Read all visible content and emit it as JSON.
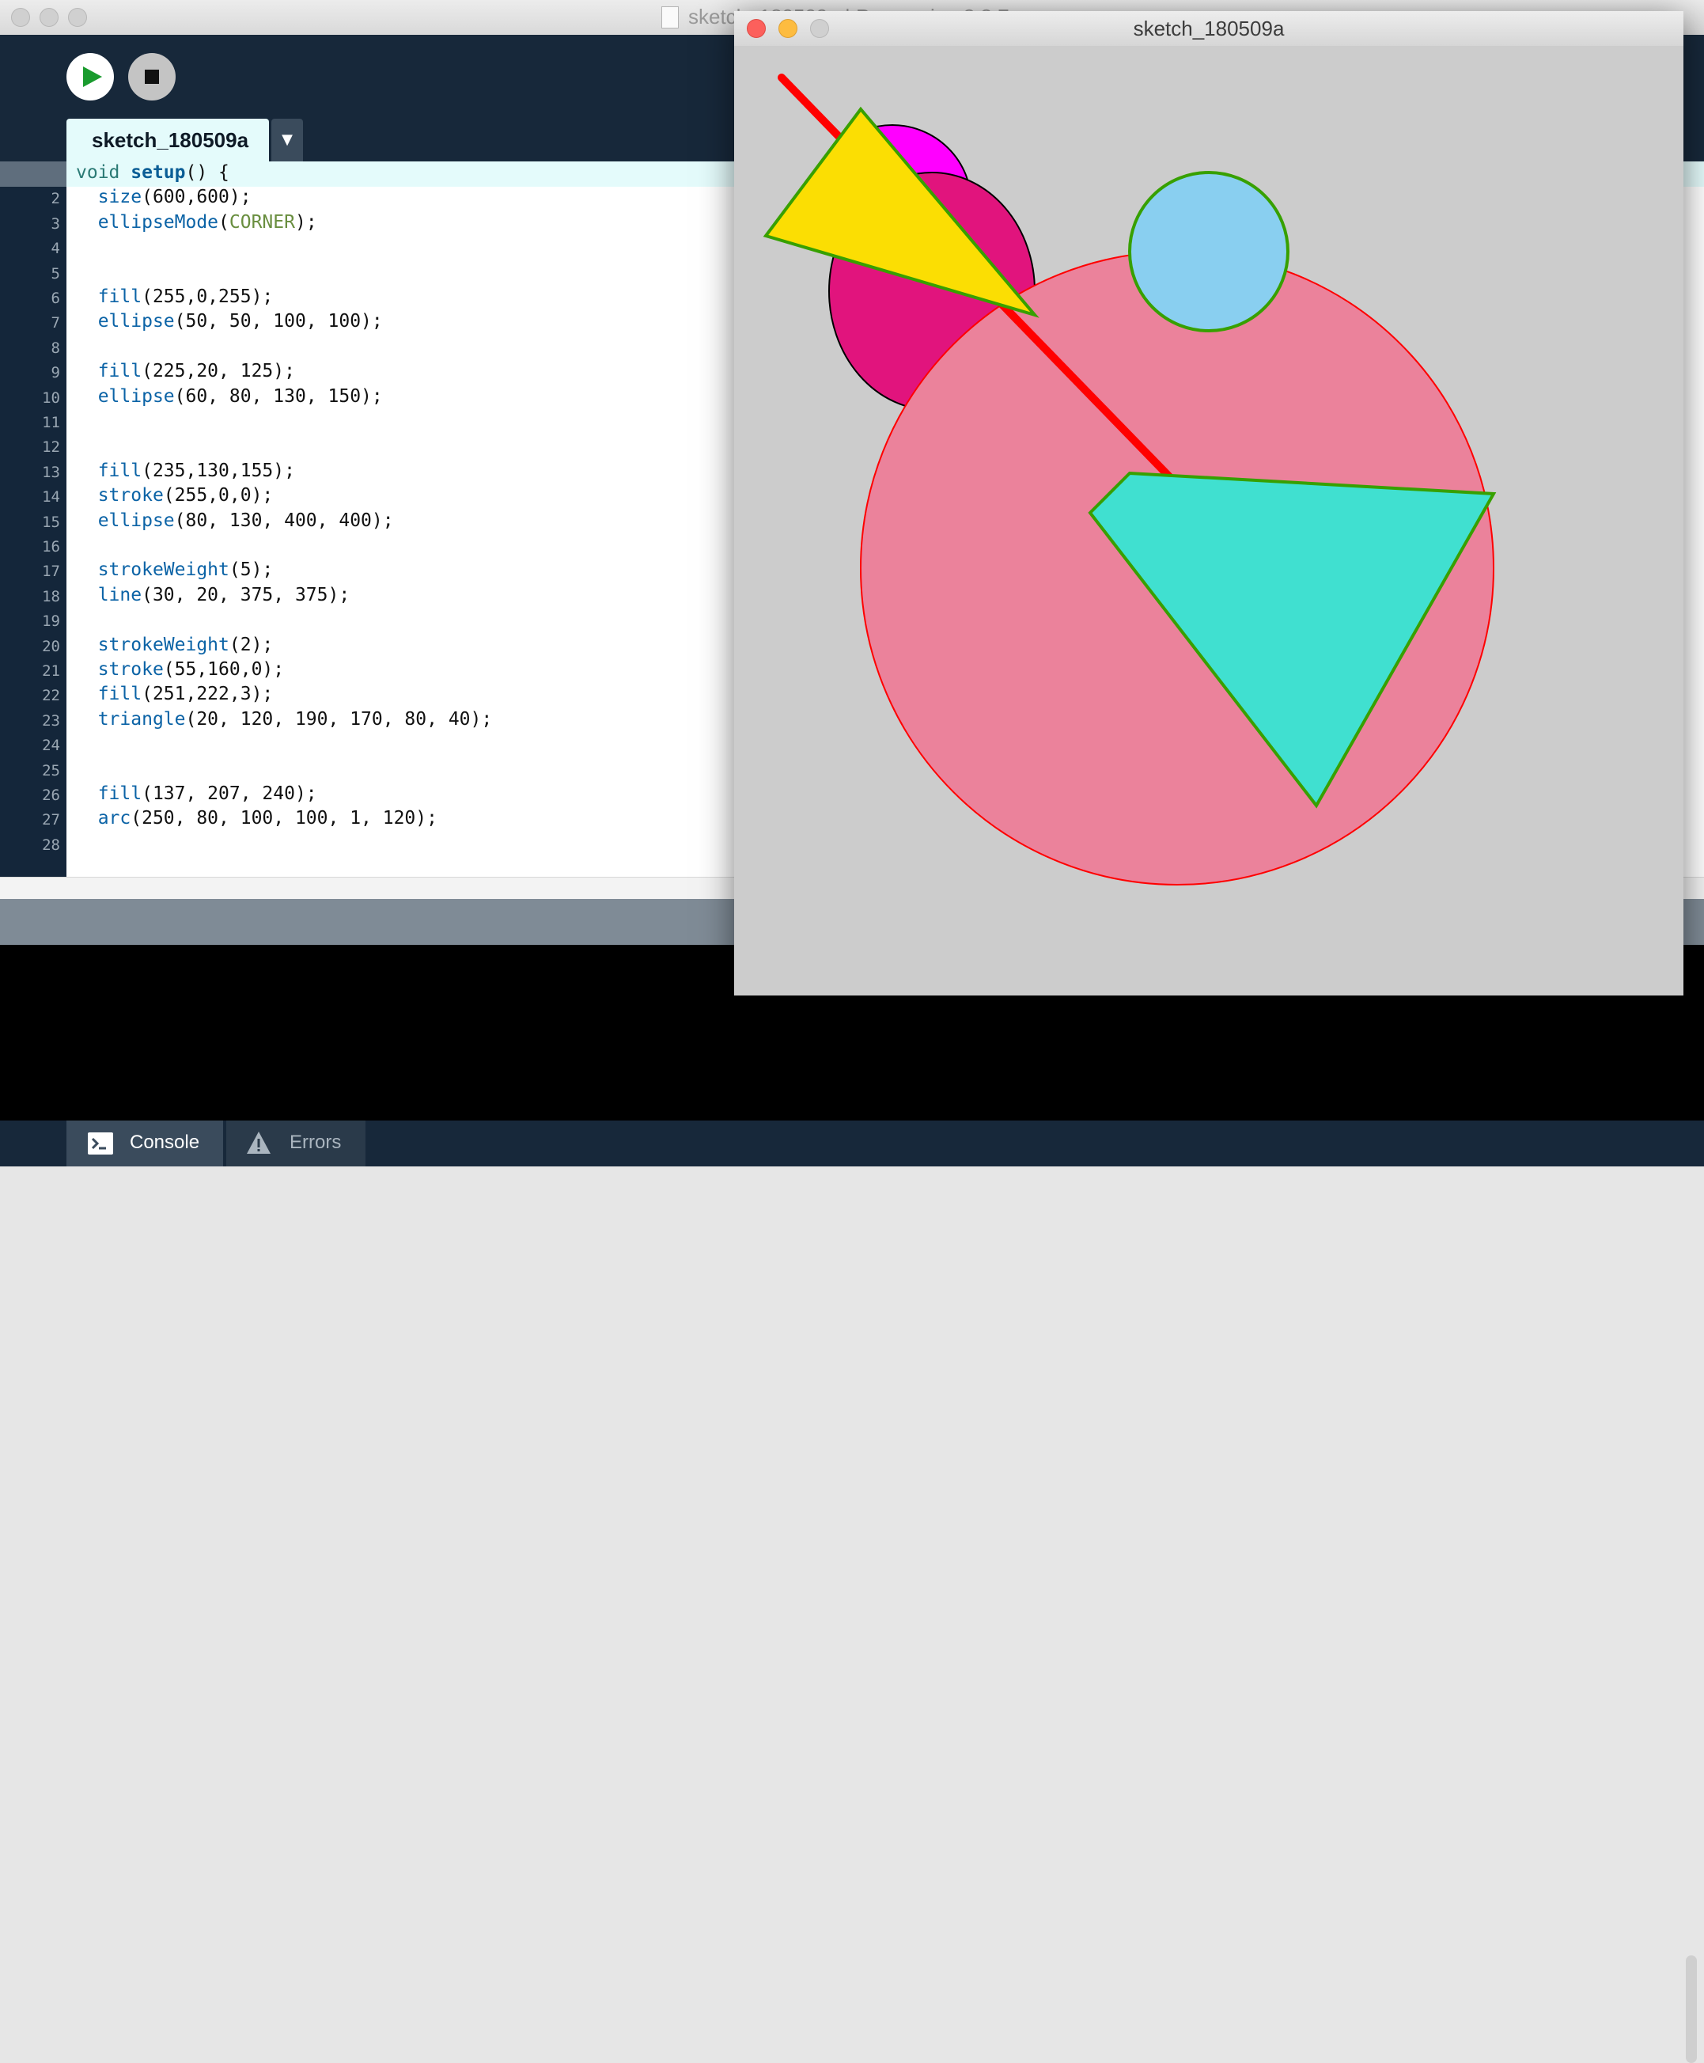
{
  "ide": {
    "window_title": "sketch_180509a | Processing 3.3.7",
    "active_tab": "sketch_180509a",
    "tab_menu_glyph": "▼",
    "current_line": 1,
    "code_lines": [
      "void setup() {",
      "  size(600,600);",
      "  ellipseMode(CORNER);",
      "",
      "",
      "  fill(255,0,255);",
      "  ellipse(50, 50, 100, 100);",
      "",
      "  fill(225,20, 125);",
      "  ellipse(60, 80, 130, 150);",
      "",
      "",
      "  fill(235,130,155);",
      "  stroke(255,0,0);",
      "  ellipse(80, 130, 400, 400);",
      "",
      "  strokeWeight(5);",
      "  line(30, 20, 375, 375);",
      "",
      "  strokeWeight(2);",
      "  stroke(55,160,0);",
      "  fill(251,222,3);",
      "  triangle(20, 120, 190, 170, 80, 40);",
      "",
      "",
      "  fill(137, 207, 240);",
      "  arc(250, 80, 100, 100, 1, 120);",
      ""
    ],
    "bottom_tabs": {
      "console": "Console",
      "errors": "Errors"
    },
    "icons": {
      "run": "play-icon",
      "stop": "stop-icon",
      "console": "terminal-icon",
      "errors": "warning-icon"
    },
    "colors": {
      "toolbar_bg": "#17283a",
      "run_icon": "#1a9b2e",
      "current_line_bg": "#e4fbfb"
    }
  },
  "sketch": {
    "window_title": "sketch_180509a",
    "background": "#cccccc"
  }
}
